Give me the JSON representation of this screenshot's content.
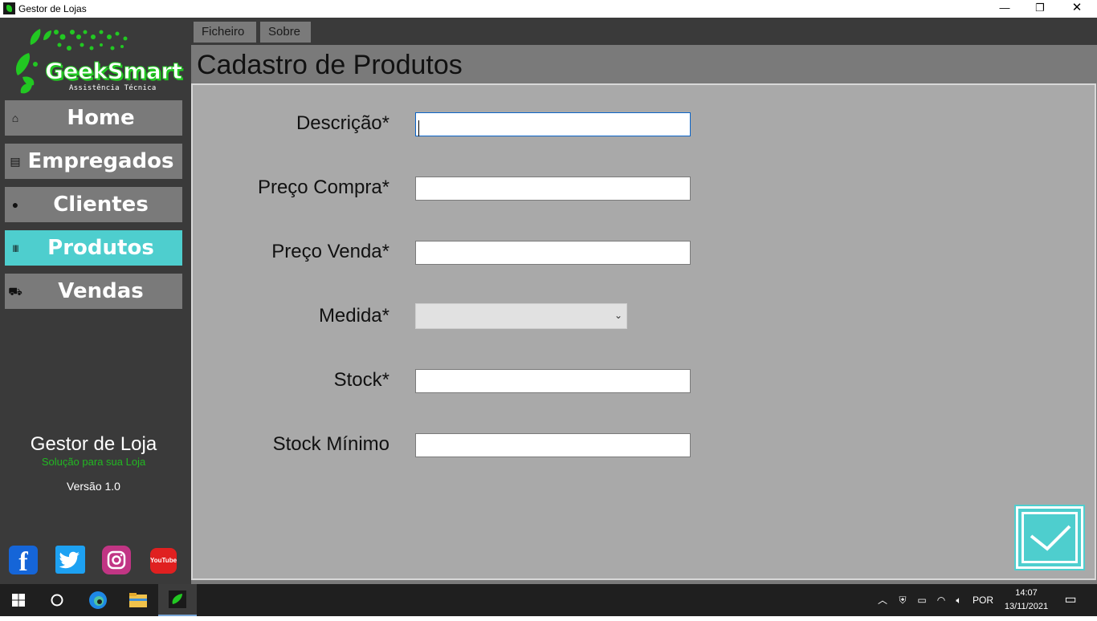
{
  "window": {
    "title": "Gestor de Lojas",
    "controls": [
      "—",
      "❐",
      "✕"
    ]
  },
  "sidebar": {
    "logo": {
      "name": "GeekSmart",
      "subtitle": "Assistência Técnica"
    },
    "items": [
      {
        "label": "Home",
        "icon": "home-icon",
        "glyph": "⌂",
        "active": false
      },
      {
        "label": "Empregados",
        "icon": "badge-icon",
        "glyph": "▤",
        "active": false
      },
      {
        "label": "Clientes",
        "icon": "user-icon",
        "glyph": "●",
        "active": false
      },
      {
        "label": "Produtos",
        "icon": "barcode-icon",
        "glyph": "|||||",
        "active": true
      },
      {
        "label": "Vendas",
        "icon": "cart-icon",
        "glyph": "⛟",
        "active": false
      }
    ],
    "app_name": "Gestor de Loja",
    "app_tagline": "Solução para sua Loja",
    "version": "Versão 1.0",
    "social": [
      {
        "name": "facebook-icon",
        "glyph": "f"
      },
      {
        "name": "twitter-icon",
        "glyph": ""
      },
      {
        "name": "instagram-icon",
        "glyph": ""
      },
      {
        "name": "youtube-icon",
        "glyph": "YouTube"
      }
    ]
  },
  "menubar": {
    "items": [
      "Ficheiro",
      "Sobre"
    ]
  },
  "page": {
    "title": "Cadastro de Produtos",
    "fields": [
      {
        "label": "Descrição*",
        "value": "",
        "type": "text",
        "focused": true
      },
      {
        "label": "Preço Compra*",
        "value": "",
        "type": "text",
        "focused": false
      },
      {
        "label": "Preço Venda*",
        "value": "",
        "type": "text",
        "focused": false
      },
      {
        "label": "Medida*",
        "value": "",
        "type": "select",
        "focused": false
      },
      {
        "label": "Stock*",
        "value": "",
        "type": "text",
        "focused": false
      },
      {
        "label": "Stock Mínimo",
        "value": "",
        "type": "text",
        "focused": false
      }
    ],
    "save_icon": "checkmark-icon"
  },
  "colors": {
    "sidebar_bg": "#3a3a3a",
    "nav_item_bg": "#7a7a7a",
    "nav_active_bg": "#4ecece",
    "panel_bg": "#a9a9a9",
    "brand_green": "#22c822"
  },
  "taskbar": {
    "tray_language": "POR",
    "time": "14:07",
    "date": "13/11/2021"
  }
}
